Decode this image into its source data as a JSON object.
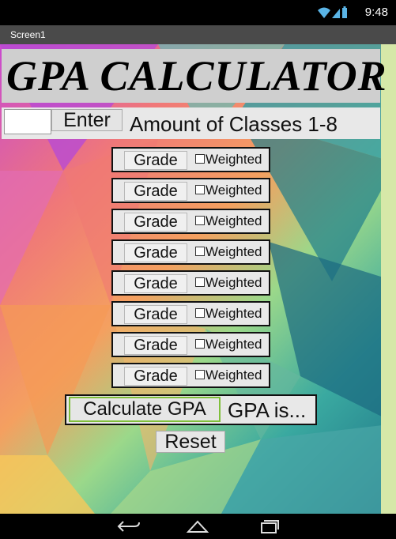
{
  "status_bar": {
    "time": "9:48",
    "icons": [
      "wifi-icon",
      "signal-icon",
      "battery-icon"
    ]
  },
  "window": {
    "title": "Screen1"
  },
  "app": {
    "title": "GPA CALCULATOR",
    "enter_button": "Enter",
    "classes_label": "Amount of Classes 1-8",
    "classes_input_value": "",
    "grade_rows": [
      {
        "button": "Grade",
        "weighted_label": "Weighted",
        "weighted_checked": false
      },
      {
        "button": "Grade",
        "weighted_label": "Weighted",
        "weighted_checked": false
      },
      {
        "button": "Grade",
        "weighted_label": "Weighted",
        "weighted_checked": false
      },
      {
        "button": "Grade",
        "weighted_label": "Weighted",
        "weighted_checked": false
      },
      {
        "button": "Grade",
        "weighted_label": "Weighted",
        "weighted_checked": false
      },
      {
        "button": "Grade",
        "weighted_label": "Weighted",
        "weighted_checked": false
      },
      {
        "button": "Grade",
        "weighted_label": "Weighted",
        "weighted_checked": false
      },
      {
        "button": "Grade",
        "weighted_label": "Weighted",
        "weighted_checked": false
      }
    ],
    "calculate_button": "Calculate GPA",
    "gpa_result": "GPA is...",
    "reset_button": "Reset"
  },
  "navigation": {
    "icons": [
      "back-icon",
      "home-icon",
      "recent-apps-icon"
    ]
  },
  "colors": {
    "header_bg": "#cfcfcf",
    "calc_button_border": "#7fbf3a",
    "right_strip": "#d6e8a8"
  }
}
